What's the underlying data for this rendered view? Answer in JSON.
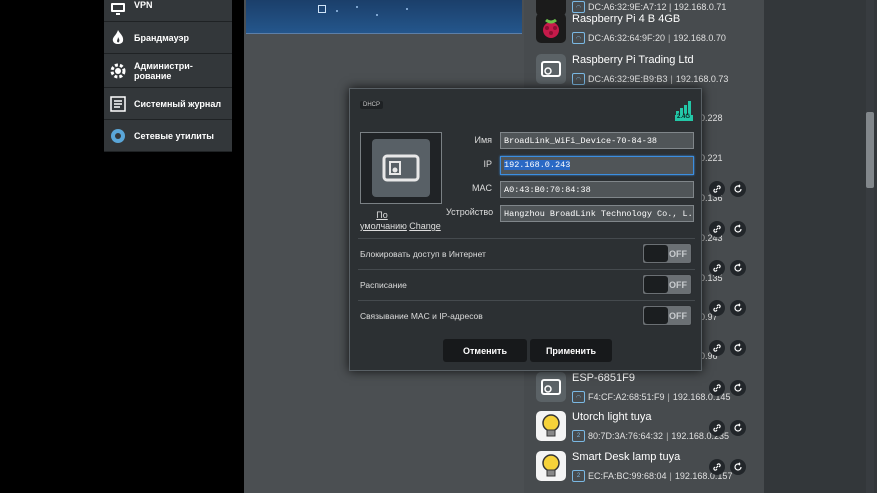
{
  "sidebar": {
    "items": [
      {
        "label": "VPN",
        "icon": "vpn-icon"
      },
      {
        "label": "Брандмауэр",
        "icon": "firewall-icon"
      },
      {
        "label": "Администри-рование",
        "icon": "admin-gear-icon"
      },
      {
        "label": "Системный журнал",
        "icon": "system-log-icon"
      },
      {
        "label": "Сетевые утилиты",
        "icon": "network-tools-icon"
      }
    ]
  },
  "clients": [
    {
      "name": "Raspberry Pi 4 B 4GB",
      "mac": "DC:A6:32:64:9F:20",
      "ip": "192.168.0.70",
      "icon": "raspberry-pi-icon"
    },
    {
      "name": "Raspberry Pi Trading Ltd",
      "mac": "DC:A6:32:9E:B9:B3",
      "ip": "192.168.0.73",
      "icon": "device-icon"
    },
    {
      "name": "ESP-6851F9",
      "mac": "F4:CF:A2:68:51:F9",
      "ip": "192.168.0.145",
      "icon": "device-icon"
    },
    {
      "name": "Utorch light tuya",
      "mac": "80:7D:3A:76:64:32",
      "ip": "192.168.0.235",
      "icon": "bulb-icon"
    },
    {
      "name": "Smart Desk lamp tuya",
      "mac": "EC:FA:BC:99:68:04",
      "ip": "192.168.0.157",
      "icon": "bulb-icon"
    }
  ],
  "client_top_partial": {
    "meta": "DC:A6:32:9E:A7:12 | 192.168.0.71"
  },
  "hidden_ips": [
    "0.228",
    "0.221",
    "0.136",
    "0.243",
    "0.135",
    "0.97",
    "0.96"
  ],
  "modal": {
    "source_tag": "DHCP",
    "band": "2.4G",
    "default_link": "По умолчанию",
    "change_link": "Change",
    "fields": {
      "name_label": "Имя",
      "name_value": "BroadLink_WiFi_Device-70-84-38",
      "ip_label": "IP",
      "ip_value": "192.168.0.243",
      "mac_label": "MAC",
      "mac_value": "A0:43:B0:70:84:38",
      "vendor_label": "Устройство",
      "vendor_value": "Hangzhou BroadLink Technology Co., L..."
    },
    "switches": [
      {
        "label": "Блокировать доступ в Интернет",
        "state": "OFF"
      },
      {
        "label": "Расписание",
        "state": "OFF"
      },
      {
        "label": "Связывание MAC и IP-адресов",
        "state": "OFF"
      }
    ],
    "cancel_label": "Отменить",
    "apply_label": "Применить"
  },
  "colors": {
    "accent": "#3c8ee0",
    "panel": "#2c3033",
    "wifi_green": "#23c7a7"
  }
}
